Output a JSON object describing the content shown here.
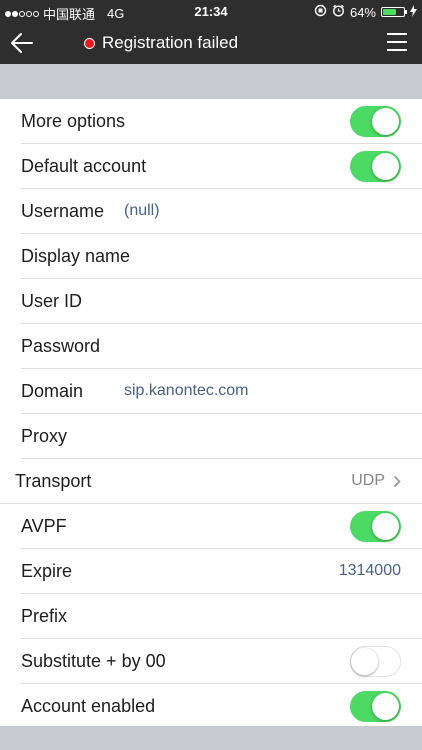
{
  "statusbar": {
    "carrier": "中国联通",
    "network": "4G",
    "time": "21:34",
    "battery": "64%",
    "battery_level": 0.64
  },
  "navbar": {
    "title": "Registration failed",
    "status_color": "#e8191f"
  },
  "settings": {
    "more_options": {
      "label": "More options",
      "enabled": true
    },
    "default_account": {
      "label": "Default account",
      "enabled": true
    },
    "username": {
      "label": "Username",
      "value": "(null)"
    },
    "display_name": {
      "label": "Display name",
      "value": ""
    },
    "user_id": {
      "label": "User ID",
      "value": ""
    },
    "password": {
      "label": "Password",
      "value": ""
    },
    "domain": {
      "label": "Domain",
      "value": "sip.kanontec.com"
    },
    "proxy": {
      "label": "Proxy",
      "value": ""
    },
    "transport": {
      "label": "Transport",
      "value": "UDP"
    },
    "avpf": {
      "label": "AVPF",
      "enabled": true
    },
    "expire": {
      "label": "Expire",
      "value": "1314000"
    },
    "prefix": {
      "label": "Prefix",
      "value": ""
    },
    "substitute": {
      "label": "Substitute + by 00",
      "enabled": false
    },
    "account_enabled": {
      "label": "Account enabled",
      "enabled": true
    }
  },
  "colors": {
    "toggle_on": "#4cd964",
    "value_text": "#4a6283",
    "header_bg": "#2e2e2e",
    "section_bg": "#c7cbd0"
  }
}
